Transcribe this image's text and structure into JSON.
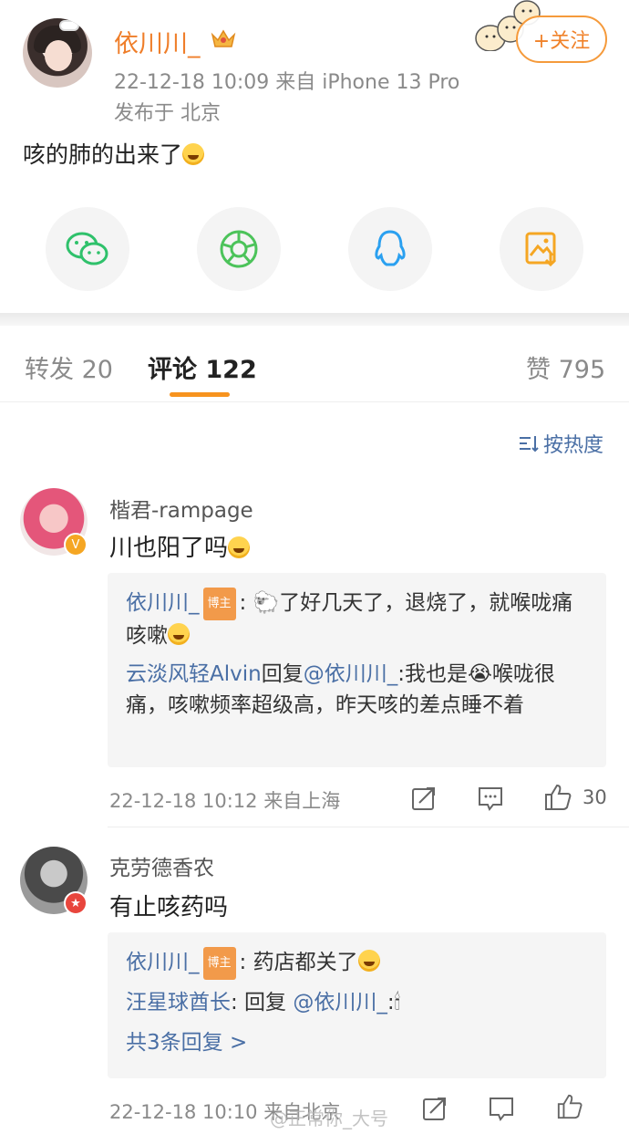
{
  "post": {
    "username": "依川川_",
    "timestamp_source": "22-12-18 10:09  来自 iPhone 13 Pro",
    "location": "发布于 北京",
    "follow_label": "+关注",
    "text": "咳的肺的出来了",
    "share_icons": [
      "wechat-icon",
      "moments-icon",
      "qq-icon",
      "save-image-icon"
    ]
  },
  "tabs": {
    "repost": "转发 20",
    "comments": "评论 122",
    "likes": "赞 795"
  },
  "sort_label": "按热度",
  "comments": [
    {
      "name": "楷君-rampage",
      "text": "川也阳了吗",
      "replies": [
        {
          "author": "依川川_",
          "tag": "博主",
          "text": ": 🐑了好几天了，退烧了，就喉咙痛咳嗽"
        },
        {
          "author": "云淡风轻Alvin",
          "prefix": "回复",
          "mention": "@依川川_",
          "text": ":我也是😭喉咙很痛，咳嗽频率超级高，昨天咳的差点睡不着"
        }
      ],
      "time": "22-12-18 10:12 来自上海",
      "likes": "30"
    },
    {
      "name": "克劳德香农",
      "text": "有止咳药吗",
      "replies": [
        {
          "author": "依川川_",
          "tag": "博主",
          "text": ": 药店都关了"
        },
        {
          "author": "汪星球酋长",
          "prefix": ": 回复 ",
          "mention": "@依川川_",
          "text": ":🕯"
        }
      ],
      "more_replies": "共3条回复 >",
      "time": "22-12-18 10:10 来自北京",
      "likes": ""
    }
  ],
  "watermark": "@正常你_大号"
}
